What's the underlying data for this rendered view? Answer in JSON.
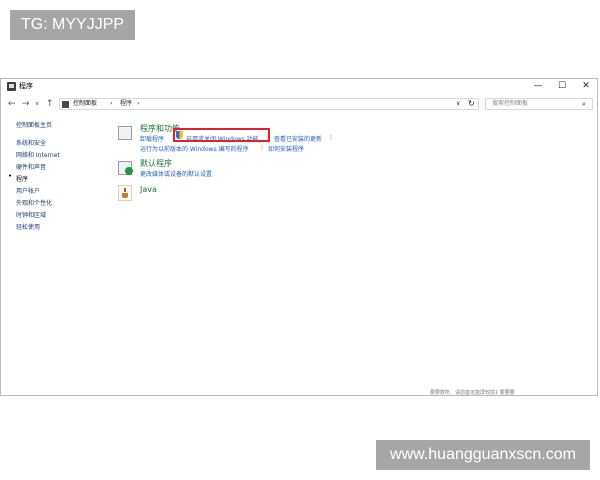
{
  "badge": {
    "text": "TG: MYYJJPP"
  },
  "window": {
    "title": "程序",
    "controls": {
      "minimize": "—",
      "maximize": "☐",
      "close": "✕"
    }
  },
  "address": {
    "back": "←",
    "forward": "→",
    "recent": "∨",
    "up": "↑",
    "crumbs": [
      "控制面板",
      "›",
      "程序",
      "›"
    ],
    "dropdown": "∨",
    "refresh": "↻",
    "search_placeholder": "搜索控制面板",
    "search_icon": "⌕"
  },
  "sidebar": {
    "items": [
      {
        "label": "控制面板主页"
      },
      {
        "label": "系统和安全"
      },
      {
        "label": "网络和 Internet"
      },
      {
        "label": "硬件和声音"
      },
      {
        "label": "程序"
      },
      {
        "label": "用户帐户"
      },
      {
        "label": "外观和个性化"
      },
      {
        "label": "时钟和区域"
      },
      {
        "label": "轻松使用"
      }
    ],
    "bullet": "•"
  },
  "main": {
    "programs": {
      "title": "程序和功能",
      "links_row1": [
        "卸载程序",
        "启用或关闭 Windows 功能",
        "查看已安装的更新"
      ],
      "links_row2": [
        "运行为以前版本的 Windows 编写的程序",
        "如何安装程序"
      ],
      "sep": "|"
    },
    "default": {
      "title": "默认程序",
      "link": "更改媒体或设备的默认设置"
    },
    "java": {
      "title": "Java"
    }
  },
  "bottom_strip": {
    "text": "要要数所、请前首定能屏较前1  要要要"
  },
  "watermark": {
    "text": "www.huangguanxscn.com"
  },
  "colors": {
    "highlight": "#d9232d",
    "link": "#2264b8",
    "category": "#1e6f34"
  }
}
